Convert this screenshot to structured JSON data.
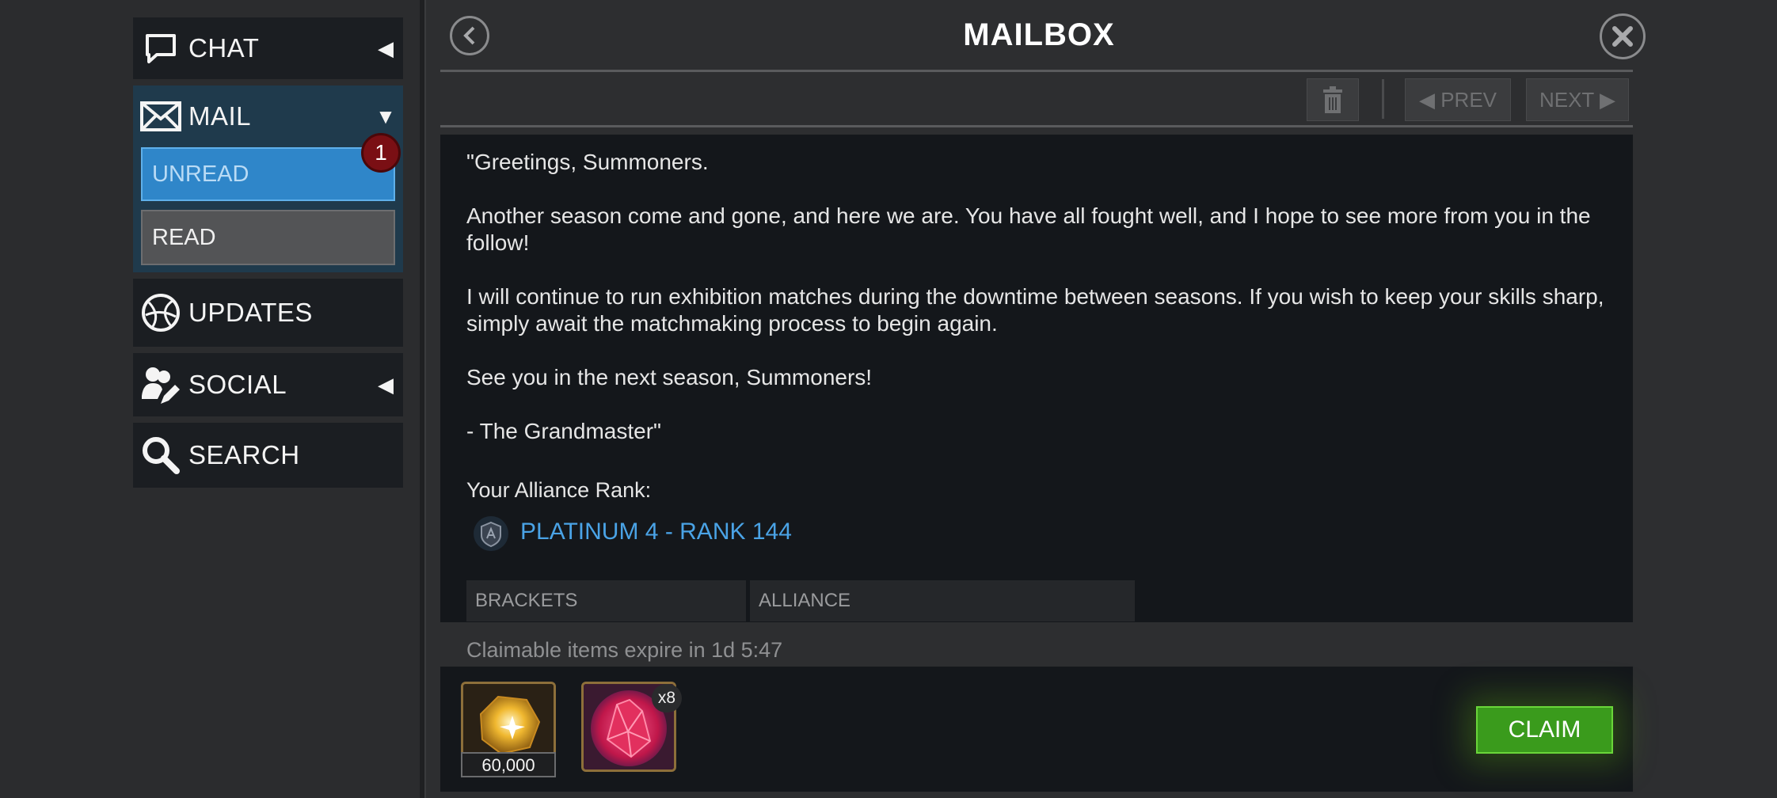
{
  "sidebar": {
    "chat": {
      "label": "CHAT",
      "icon": "chat-bubble-icon"
    },
    "mail": {
      "label": "MAIL",
      "icon": "envelope-icon"
    },
    "unread": {
      "label": "UNREAD",
      "badge": "1"
    },
    "read": {
      "label": "READ"
    },
    "updates": {
      "label": "UPDATES",
      "icon": "globe-icon"
    },
    "social": {
      "label": "SOCIAL",
      "icon": "people-edit-icon"
    },
    "search": {
      "label": "SEARCH",
      "icon": "search-icon"
    }
  },
  "header": {
    "title": "MAILBOX",
    "prev_label": "◀ PREV",
    "next_label": "NEXT ▶"
  },
  "message": {
    "paragraphs": [
      "\"Greetings, Summoners.",
      "Another season come and gone, and here we are. You have all fought well, and I hope to see more from you in the follow!",
      "I will continue to run exhibition matches during the downtime between seasons. If you wish to keep your skills sharp, simply await the matchmaking process to begin again.",
      "See you in the next season, Summoners!",
      "- The Grandmaster\""
    ],
    "rank_label": "Your Alliance Rank:",
    "rank_value": "PLATINUM 4 - RANK 144",
    "table_headers": [
      "BRACKETS",
      "ALLIANCE"
    ]
  },
  "rewards": {
    "expire_text": "Claimable items expire in 1d 5:47",
    "items": [
      {
        "icon": "gold-crystal-icon",
        "quantity": "60,000"
      },
      {
        "icon": "red-crystal-icon",
        "multiplier": "x8"
      }
    ],
    "claim_label": "CLAIM"
  },
  "colors": {
    "accent_blue": "#2f86c9",
    "rank_blue": "#4aa3e6",
    "claim_green": "#3a9b1c",
    "badge_red": "#7a0f14"
  }
}
